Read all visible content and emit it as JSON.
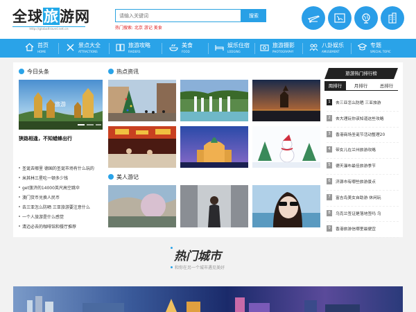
{
  "header": {
    "logo_text_a": "全球",
    "logo_text_b": "旅",
    "logo_text_c": "游网",
    "logo_url": "http://globaltravel.net.cn",
    "search_placeholder": "请输入关键词",
    "search_button": "搜索",
    "hot_search": "热门搜索: 北京 游记 美食",
    "icons": [
      "plane-icon",
      "map-icon",
      "globe-icon",
      "city-icon"
    ]
  },
  "nav": [
    {
      "cn": "首页",
      "en": "HOME",
      "icon": "home-icon"
    },
    {
      "cn": "景点大全",
      "en": "ATTRACTIONS",
      "icon": "tools-icon"
    },
    {
      "cn": "旅游攻略",
      "en": "RAIDERS",
      "icon": "book-icon"
    },
    {
      "cn": "美食",
      "en": "FOOD",
      "icon": "food-icon"
    },
    {
      "cn": "娱乐住宿",
      "en": "LODGING",
      "icon": "bed-icon"
    },
    {
      "cn": "旅游摄影",
      "en": "PHOTOGRAPHY",
      "icon": "camera-icon"
    },
    {
      "cn": "八卦娱乐",
      "en": "AMUSEMENT",
      "icon": "people-icon"
    },
    {
      "cn": "专题",
      "en": "SPECIAL TOPIC",
      "icon": "graduation-icon"
    }
  ],
  "today": {
    "title": "今日头条",
    "feature_title": "狭路相逢，不知蜡蜂出行",
    "news": [
      "圣诞去哪里 德国的圣诞市场有什么玩的",
      "米其林三星吃一顿多少钱",
      "get菠济的14000英尺高空跳伞",
      "澳门货币兑换人民币",
      "去三亚怎么防晒 三亚旅游要注意什么",
      "一个人旅游是什么感觉",
      "清迈必去的咖啡馆和餐厅推荐"
    ]
  },
  "hot_info": {
    "title": "热点资讯"
  },
  "travel_notes": {
    "title": "美人游记"
  },
  "ranking": {
    "title": "旅游热门排行榜",
    "tabs": [
      "周排行",
      "月排行",
      "总排行"
    ],
    "items": [
      "去三亚怎么防晒 三亚旅游",
      "去大理玩你该知道这些攻略",
      "香港商场圣诞节活动整理20",
      "带女儿在兰州旅游攻略",
      "德天瀑布最佳旅游季节",
      "济源市有哪些旅游景点",
      "富吉岛美女自助游 休闲玩",
      "乌克兰签证是落地签吗 乌",
      "香港旅游信哪里最便宜"
    ]
  },
  "hot_city": {
    "title": "热门城市",
    "subtitle": "和你在另一个城市遇见美好"
  },
  "colors": {
    "primary": "#2aa3e8",
    "accent_red": "#e02020",
    "dark": "#222222"
  }
}
